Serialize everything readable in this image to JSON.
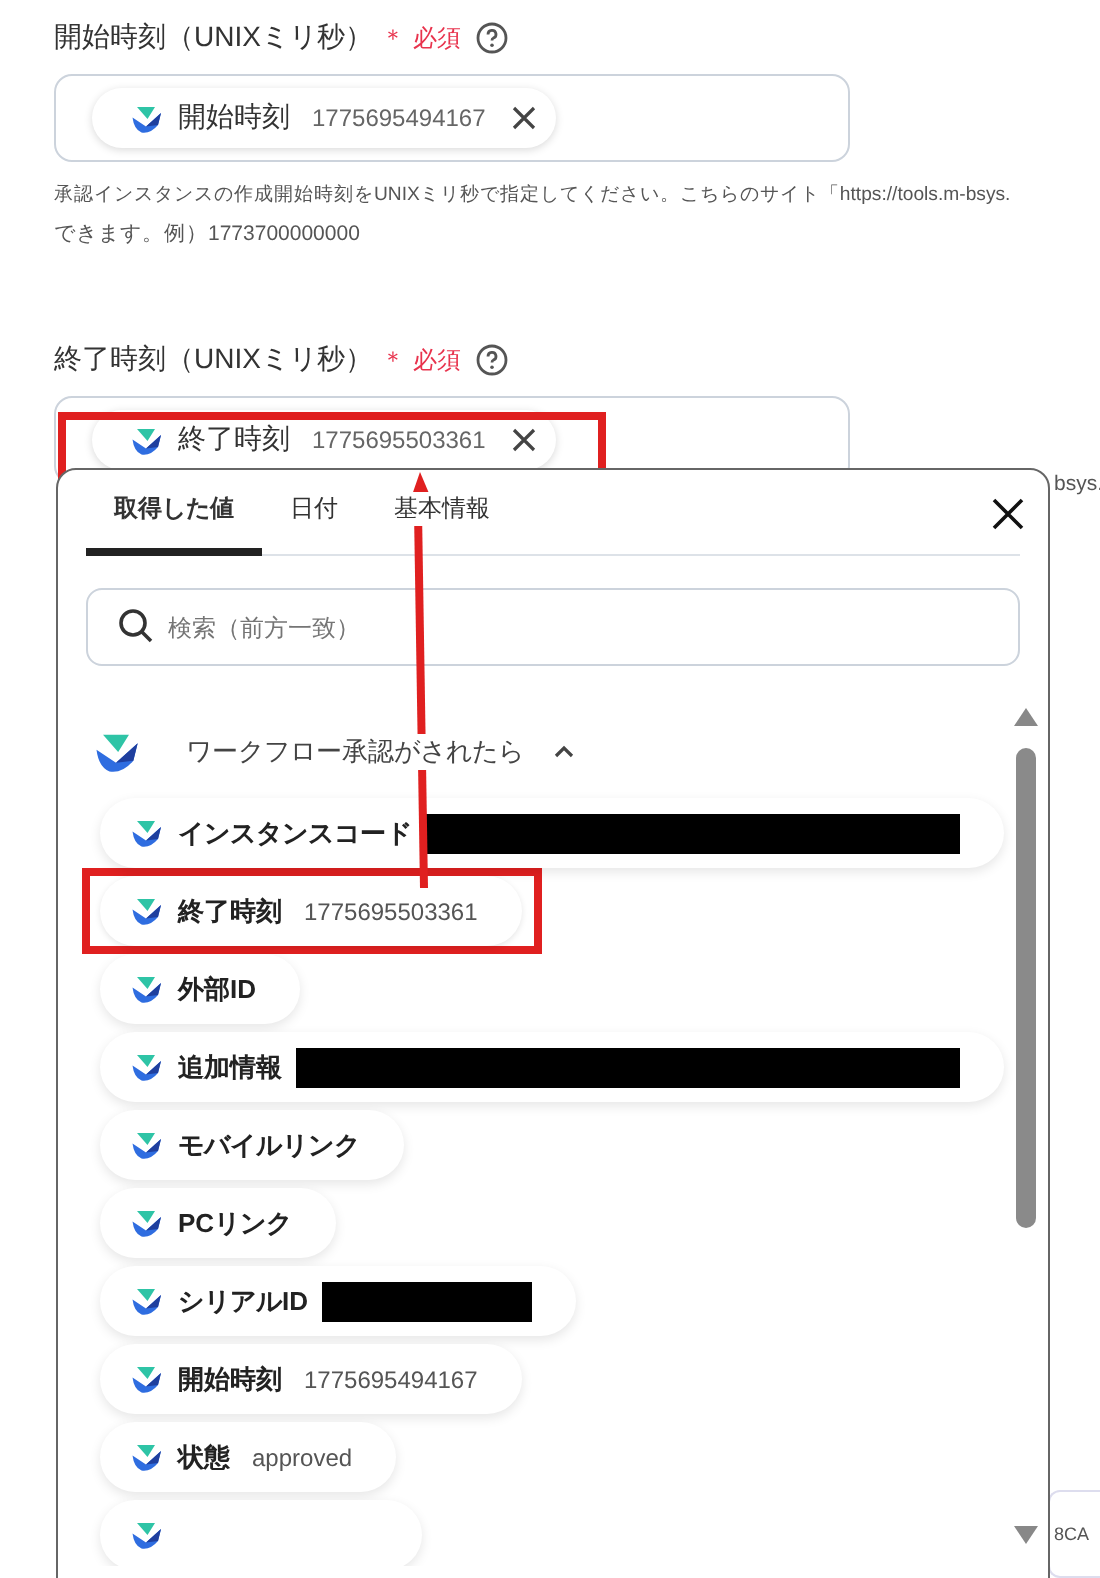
{
  "fields": [
    {
      "label": "開始時刻（UNIXミリ秒）",
      "required_mark": "＊",
      "required": "必須",
      "chip": {
        "name": "開始時刻",
        "value": "1775695494167",
        "highlighted": false
      },
      "help": "承認インスタンスの作成開始時刻をUNIXミリ秒で指定してください。こちらのサイト「https://tools.m-bsys.",
      "help_2": "できます。例）1773700000000"
    },
    {
      "label": "終了時刻（UNIXミリ秒）",
      "required_mark": "＊",
      "required": "必須",
      "chip": {
        "name": "終了時刻",
        "value": "1775695503361",
        "highlighted": true
      },
      "help_fragment": "bsys."
    }
  ],
  "background_fragment": "8CA",
  "popup": {
    "tabs": [
      {
        "label": "取得した値",
        "selected": true
      },
      {
        "label": "日付",
        "selected": false
      },
      {
        "label": "基本情報",
        "selected": false
      }
    ],
    "search": {
      "placeholder": "検索（前方一致）"
    },
    "group": {
      "title": "ワークフロー承認がされたら",
      "expanded": true
    },
    "items": [
      {
        "kind": "redacted_long",
        "name": "インスタンスコード",
        "highlighted": false
      },
      {
        "kind": "text",
        "name": "終了時刻",
        "value": "1775695503361",
        "highlighted": true
      },
      {
        "kind": "text",
        "name": "外部ID",
        "highlighted": false
      },
      {
        "kind": "redacted_long",
        "name": "追加情報",
        "highlighted": false
      },
      {
        "kind": "text",
        "name": "モバイルリンク",
        "highlighted": false
      },
      {
        "kind": "text",
        "name": "PCリンク",
        "highlighted": false
      },
      {
        "kind": "redacted_short",
        "name": "シリアルID",
        "highlighted": false
      },
      {
        "kind": "text",
        "name": "開始時刻",
        "value": "1775695494167",
        "highlighted": false
      },
      {
        "kind": "text",
        "name": "状態",
        "value": "approved",
        "highlighted": false
      },
      {
        "kind": "cut_off",
        "highlighted": false
      }
    ]
  }
}
